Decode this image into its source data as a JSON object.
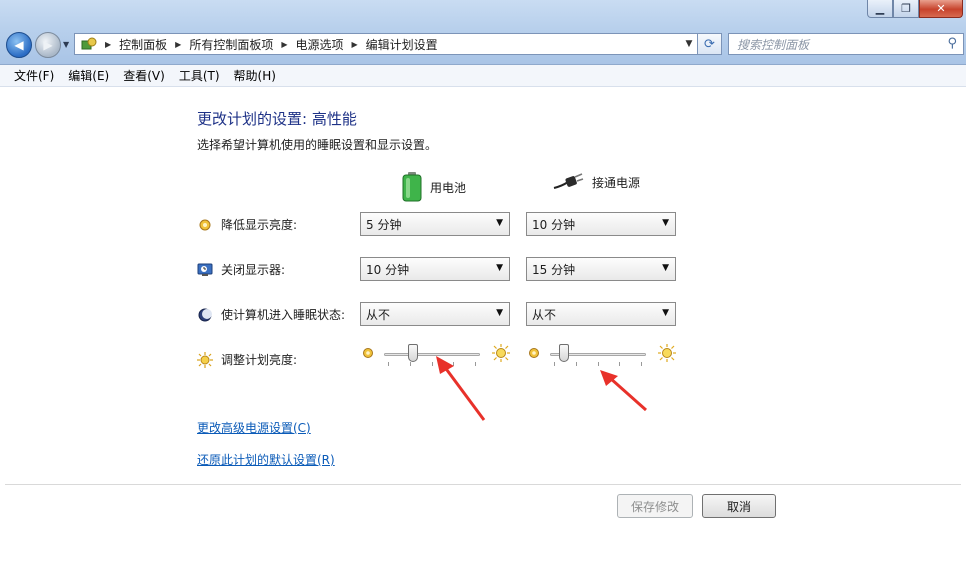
{
  "window": {
    "controls": {
      "minimize": "▁",
      "maximize": "❐",
      "close": "✕"
    }
  },
  "nav": {
    "back_glyph": "◀",
    "forward_glyph": "▶",
    "breadcrumbs": [
      "控制面板",
      "所有控制面板项",
      "电源选项",
      "编辑计划设置"
    ],
    "search_placeholder": "搜索控制面板"
  },
  "menubar": {
    "items": [
      "文件(F)",
      "编辑(E)",
      "查看(V)",
      "工具(T)",
      "帮助(H)"
    ]
  },
  "page": {
    "title": "更改计划的设置: 高性能",
    "description": "选择希望计算机使用的睡眠设置和显示设置。",
    "columns": {
      "battery": "用电池",
      "plugged": "接通电源"
    },
    "rows": [
      {
        "label": "降低显示亮度:",
        "icon": "dim-display-icon",
        "battery": "5 分钟",
        "plugged": "10 分钟"
      },
      {
        "label": "关闭显示器:",
        "icon": "monitor-off-icon",
        "battery": "10 分钟",
        "plugged": "15 分钟"
      },
      {
        "label": "使计算机进入睡眠状态:",
        "icon": "sleep-moon-icon",
        "battery": "从不",
        "plugged": "从不"
      }
    ],
    "brightness": {
      "label": "调整计划亮度:",
      "battery_level": 0.3,
      "plugged_level": 0.15
    },
    "links": {
      "advanced": "更改高级电源设置(C)",
      "restore": "还原此计划的默认设置(R)"
    },
    "buttons": {
      "save": "保存修改",
      "cancel": "取消"
    }
  },
  "colors": {
    "accent_title": "#1e3287",
    "link": "#0b5bb8",
    "annotation_arrow": "#e8312a"
  }
}
